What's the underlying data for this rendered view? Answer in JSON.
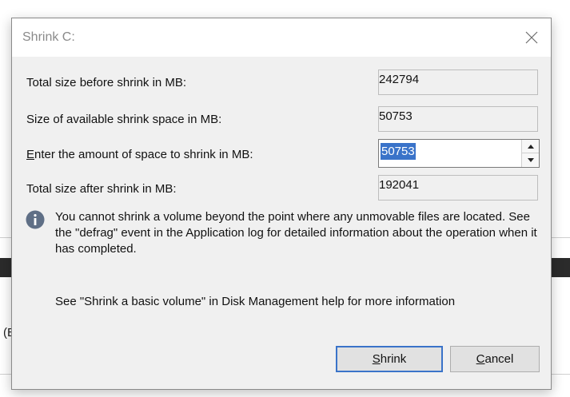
{
  "background": {
    "partial_text": "(E"
  },
  "dialog": {
    "title": "Shrink C:",
    "fields": {
      "total_before": {
        "label": "Total size before shrink in MB:",
        "value": "242794"
      },
      "available": {
        "label": "Size of available shrink space in MB:",
        "value": "50753"
      },
      "amount": {
        "label_accel": "E",
        "label_rest": "nter the amount of space to shrink in MB:",
        "value": "50753"
      },
      "total_after": {
        "label": "Total size after shrink in MB:",
        "value": "192041"
      }
    },
    "info_text": "You cannot shrink a volume beyond the point where any unmovable files are located. See the \"defrag\" event in the Application log for detailed information about the operation when it has completed.",
    "help_text": "See \"Shrink a basic volume\" in Disk Management help for more information",
    "buttons": {
      "shrink_accel": "S",
      "shrink_rest": "hrink",
      "cancel_accel": "C",
      "cancel_rest": "ancel"
    }
  },
  "colors": {
    "accent": "#3a73c9",
    "dialog_bg": "#f0f0f0",
    "info_icon": "#5f6f86"
  },
  "icons": {
    "close": "close-icon",
    "info": "info-icon",
    "spin_up": "chevron-up-icon",
    "spin_down": "chevron-down-icon"
  }
}
